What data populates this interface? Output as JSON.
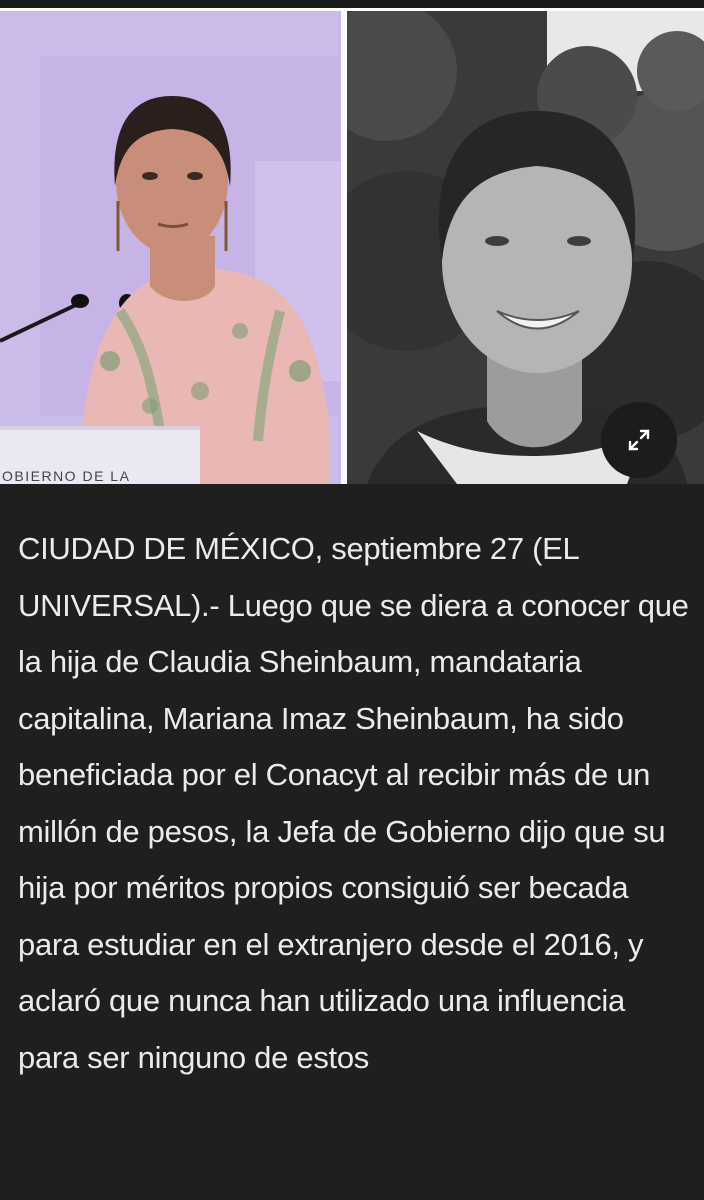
{
  "gallery": {
    "left_photo": {
      "label": "photo-speaker-at-podium",
      "podium_text": "OBIERNO DE LA"
    },
    "right_photo": {
      "label": "photo-portrait-black-and-white"
    },
    "expand_icon": "expand-arrows-icon"
  },
  "article": {
    "body": "CIUDAD DE MÉXICO, septiembre 27 (EL UNIVERSAL).- Luego que se diera a conocer que la hija de Claudia Sheinbaum, mandataria capitalina, Mariana Imaz Sheinbaum, ha sido beneficiada por el Conacyt al recibir más de un millón de pesos, la Jefa de Gobierno dijo que su hija por méritos propios consiguió ser becada para estudiar en el extranjero desde el 2016, y aclaró que nunca han utilizado una influencia para ser ninguno de estos"
  },
  "colors": {
    "background": "#1f1f1f",
    "text": "#ebebeb",
    "left_photo_bg": "#c9b7e7"
  }
}
